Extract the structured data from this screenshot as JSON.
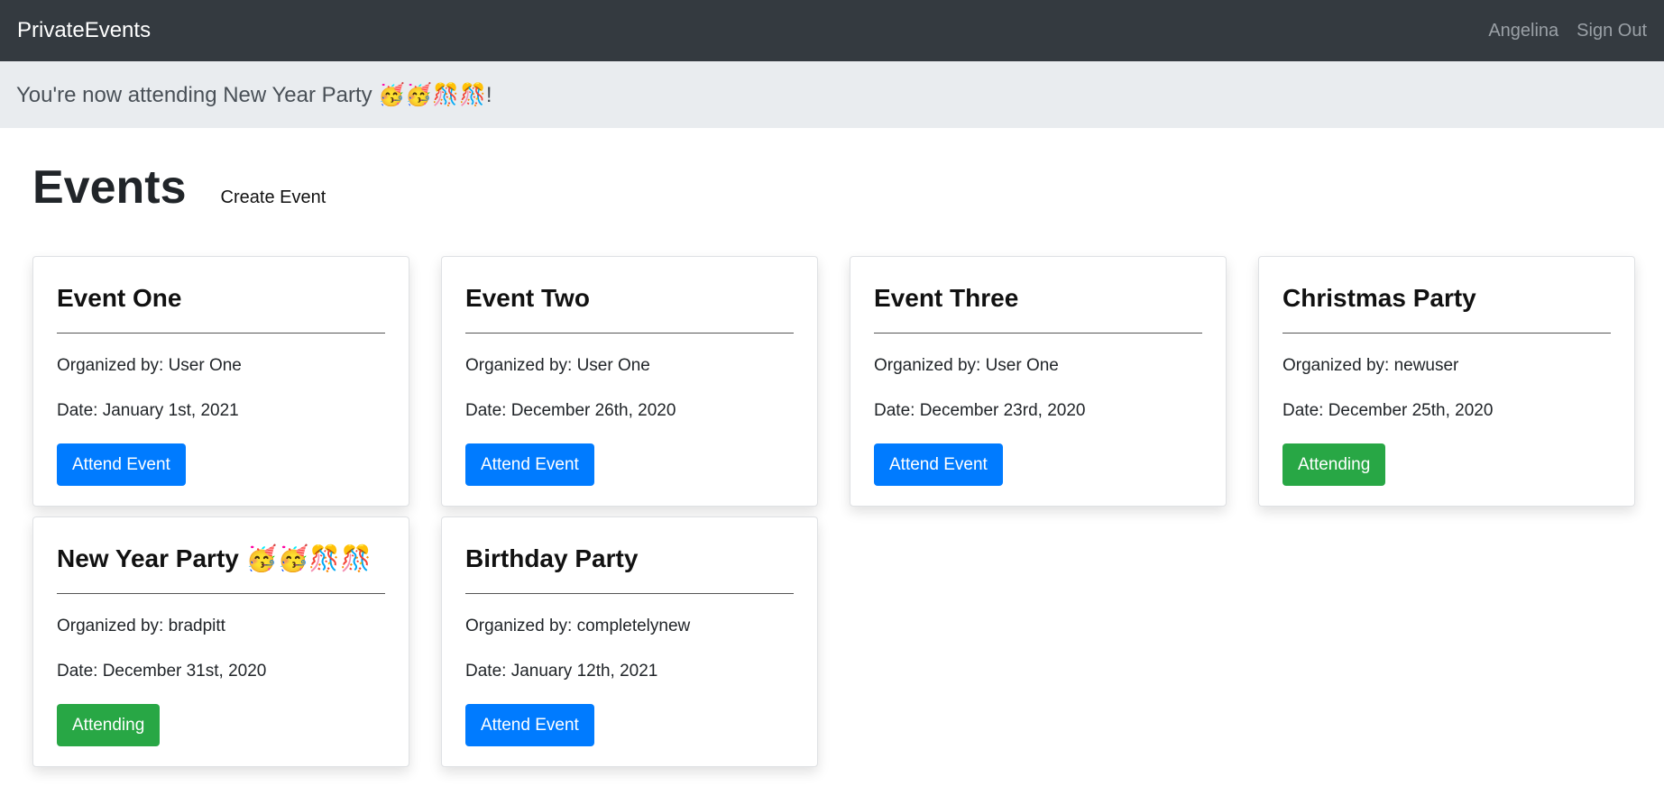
{
  "navbar": {
    "brand": "PrivateEvents",
    "user": "Angelina",
    "sign_out": "Sign Out"
  },
  "alert": {
    "message": "You're now attending New Year Party 🥳🥳🎊🎊!"
  },
  "page": {
    "title": "Events",
    "create_link": "Create Event"
  },
  "colors": {
    "navbar_bg": "#343a40",
    "alert_bg": "#e9ecef",
    "primary": "#007bff",
    "success": "#28a745"
  },
  "events": [
    {
      "title": "Event One",
      "organizer": "Organized by: User One",
      "date": "Date: January 1st, 2021",
      "button": "Attend Event",
      "status": "attend"
    },
    {
      "title": "Event Two",
      "organizer": "Organized by: User One",
      "date": "Date: December 26th, 2020",
      "button": "Attend Event",
      "status": "attend"
    },
    {
      "title": "Event Three",
      "organizer": "Organized by: User One",
      "date": "Date: December 23rd, 2020",
      "button": "Attend Event",
      "status": "attend"
    },
    {
      "title": "Christmas Party",
      "organizer": "Organized by: newuser",
      "date": "Date: December 25th, 2020",
      "button": "Attending",
      "status": "attending"
    },
    {
      "title": "New Year Party 🥳🥳🎊🎊",
      "organizer": "Organized by: bradpitt",
      "date": "Date: December 31st, 2020",
      "button": "Attending",
      "status": "attending"
    },
    {
      "title": "Birthday Party",
      "organizer": "Organized by: completelynew",
      "date": "Date: January 12th, 2021",
      "button": "Attend Event",
      "status": "attend"
    }
  ]
}
